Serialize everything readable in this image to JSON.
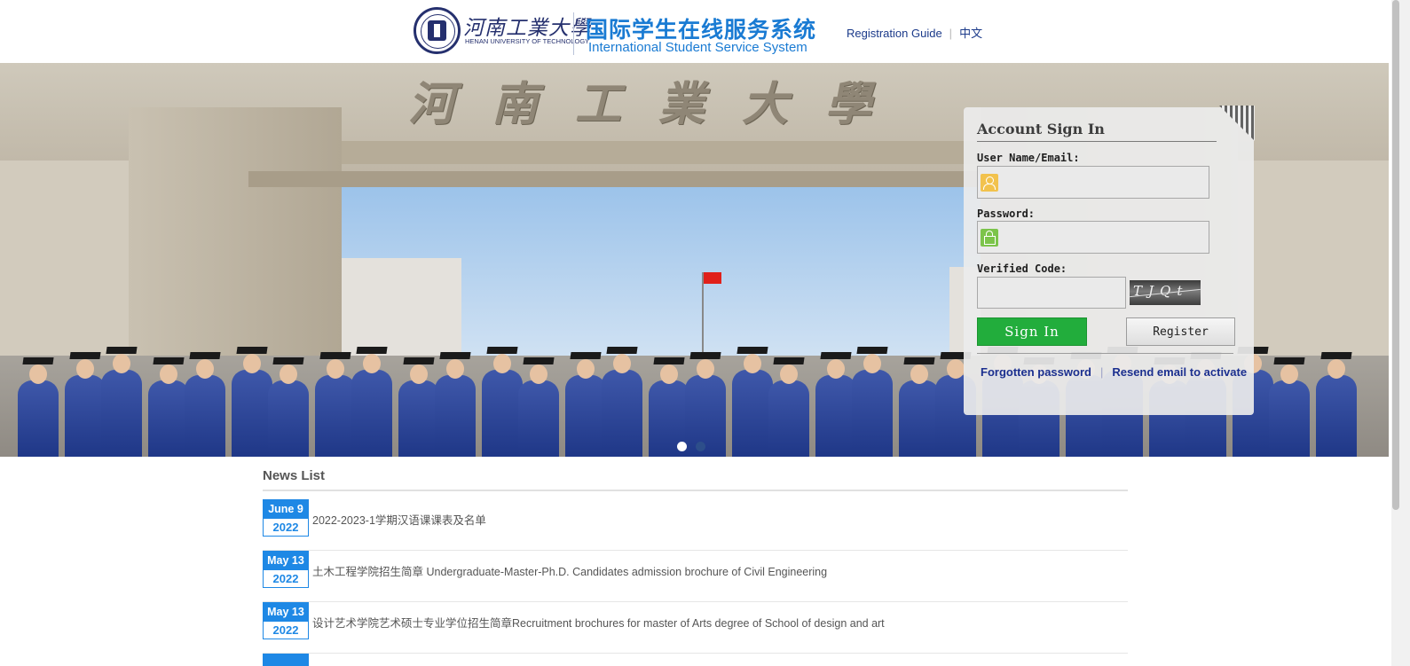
{
  "header": {
    "logo_cn": "河南工業大學",
    "logo_en": "HENAN UNIVERSITY OF TECHNOLOGY",
    "system_cn": "国际学生在线服务系统",
    "system_en": "International Student Service System",
    "nav": [
      {
        "label": "Registration Guide"
      },
      {
        "label": "中文"
      }
    ]
  },
  "banner": {
    "gate_text": "河南工業大學",
    "slide_count": 2,
    "active_slide": 1
  },
  "login": {
    "title": "Account Sign In",
    "username_label": "User Name/Email:",
    "username_value": "",
    "password_label": "Password:",
    "password_value": "",
    "code_label": "Verified Code:",
    "code_value": "",
    "captcha_text": "TJQt",
    "signin_label": "Sign In",
    "register_label": "Register",
    "forgot_label": "Forgotten password",
    "resend_label": "Resend email to activate"
  },
  "news": {
    "title": "News List",
    "items": [
      {
        "month_day": "June 9",
        "year": "2022",
        "text": "2022-2023-1学期汉语课课表及名单"
      },
      {
        "month_day": "May 13",
        "year": "2022",
        "text": "土木工程学院招生简章 Undergraduate-Master-Ph.D. Candidates admission brochure of Civil Engineering"
      },
      {
        "month_day": "May 13",
        "year": "2022",
        "text": "设计艺术学院艺术硕士专业学位招生简章Recruitment brochures for master of Arts degree of School of design and art"
      }
    ]
  },
  "colors": {
    "brand_blue": "#1a7bd3",
    "navy": "#25306e",
    "signin_green": "#22ad3c",
    "date_blue": "#1e88e5"
  }
}
